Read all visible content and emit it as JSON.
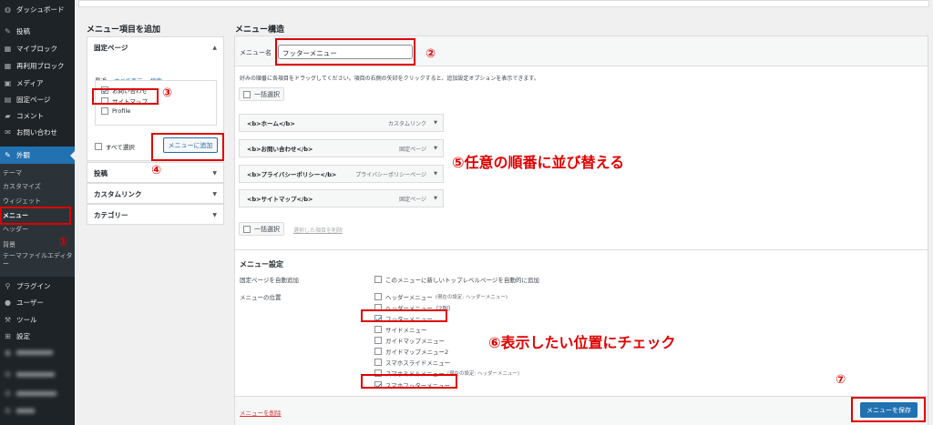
{
  "sidebar": {
    "items": [
      {
        "label": "ダッシュボード",
        "icon": "dashboard-icon"
      },
      {
        "label": "投稿",
        "icon": "pin-icon"
      },
      {
        "label": "マイブロック",
        "icon": "block-icon"
      },
      {
        "label": "再利用ブロック",
        "icon": "block-icon"
      },
      {
        "label": "メディア",
        "icon": "media-icon"
      },
      {
        "label": "固定ページ",
        "icon": "page-icon"
      },
      {
        "label": "コメント",
        "icon": "comment-icon"
      },
      {
        "label": "お問い合わせ",
        "icon": "mail-icon"
      },
      {
        "label": "外観",
        "icon": "brush-icon"
      }
    ],
    "submenu": [
      "テーマ",
      "カスタマイズ",
      "ウィジェット",
      "メニュー",
      "ヘッダー",
      "背景",
      "テーマファイルエディター"
    ],
    "lower_items": [
      {
        "label": "プラグイン",
        "icon": "plugin-icon"
      },
      {
        "label": "ユーザー",
        "icon": "user-icon"
      },
      {
        "label": "ツール",
        "icon": "tool-icon"
      },
      {
        "label": "設定",
        "icon": "settings-icon"
      }
    ]
  },
  "add_items": {
    "title": "メニュー項目を追加",
    "pages_section": "固定ページ",
    "tabs": [
      "最近",
      "すべて表示",
      "検索"
    ],
    "pages": [
      {
        "label": "お問い合わせ",
        "checked": true
      },
      {
        "label": "サイトマップ",
        "checked": false
      },
      {
        "label": "Profile",
        "checked": false
      }
    ],
    "select_all": "すべて選択",
    "add_button": "メニューに追加",
    "other_sections": [
      "投稿",
      "カスタムリンク",
      "カテゴリー"
    ]
  },
  "structure": {
    "title": "メニュー構造",
    "name_label": "メニュー名",
    "name_value": "フッターメニュー",
    "instructions": "好みの順番に各項目をドラッグしてください。項目の右側の矢印をクリックすると、追加設定オプションを表示できます。",
    "bulk_select": "一括選択",
    "items": [
      {
        "label": "<b>ホーム</b>",
        "type": "カスタムリンク"
      },
      {
        "label": "<b>お問い合わせ</b>",
        "type": "固定ページ"
      },
      {
        "label": "<b>プライバシーポリシー</b>",
        "type": "プライバシーポリシーページ"
      },
      {
        "label": "<b>サイトマップ</b>",
        "type": "固定ページ"
      }
    ],
    "remove_selected": "選択した項目を削除"
  },
  "settings": {
    "title": "メニュー設定",
    "auto_add_label": "固定ページを自動追加",
    "auto_add_option": "このメニューに新しいトップレベルページを自動的に追加",
    "location_label": "メニューの位置",
    "locations": [
      {
        "label": "ヘッダーメニュー",
        "note": "(現在の設定: ヘッダーメニュー)",
        "checked": false
      },
      {
        "label": "ヘッダーメニュー（2列）",
        "note": "",
        "checked": false
      },
      {
        "label": "フッターメニュー",
        "note": "",
        "checked": true
      },
      {
        "label": "サイドメニュー",
        "note": "",
        "checked": false
      },
      {
        "label": "ガイドマップメニュー",
        "note": "",
        "checked": false
      },
      {
        "label": "ガイドマップメニュー2",
        "note": "",
        "checked": false
      },
      {
        "label": "スマホスライドメニュー",
        "note": "",
        "checked": false
      },
      {
        "label": "スマホミドルメニュー",
        "note": "(現在の設定: ヘッダーメニュー)",
        "checked": false
      },
      {
        "label": "スマホフッターメニュー",
        "note": "",
        "checked": true
      }
    ]
  },
  "footer": {
    "delete_menu": "メニューを削除",
    "save_button": "メニューを保存"
  },
  "annotations": {
    "n1": "①",
    "n2": "②",
    "n3": "③",
    "n4": "④",
    "n7": "⑦",
    "step5": "⑤任意の順番に並び替える",
    "step6": "⑥表示したい位置にチェック"
  },
  "colors": {
    "accent": "#2271b1",
    "annotation": "#e00000",
    "sidebar": "#1d2327"
  }
}
